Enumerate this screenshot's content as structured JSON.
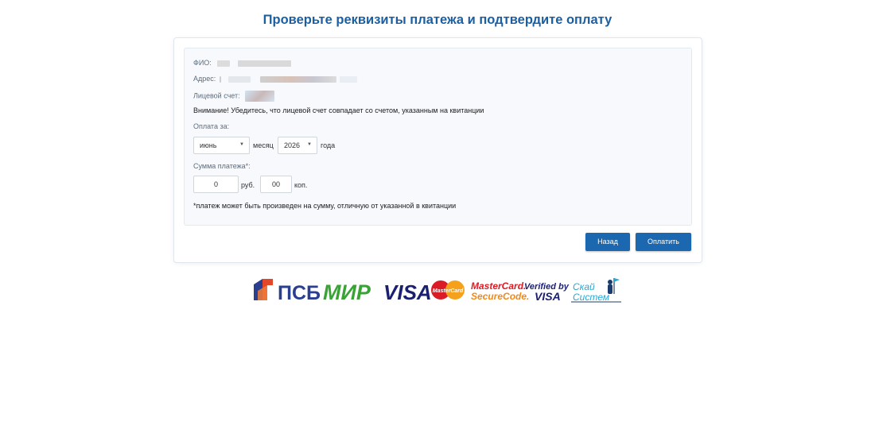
{
  "title": "Проверьте реквизиты платежа и подтвердите оплату",
  "details": {
    "fio_label": "ФИО:",
    "address_label": "Адрес:",
    "account_label": "Лицевой счет:",
    "warning": "Внимание! Убедитесь, что лицевой счет совпадает со счетом, указанным на квитанции"
  },
  "payment_period": {
    "label": "Оплата за:",
    "month_value": "июнь",
    "month_unit": "месяц",
    "year_value": "2026",
    "year_unit": "года"
  },
  "amount": {
    "label": "Сумма платежа*:",
    "rubles_value": "0",
    "rubles_unit": "руб.",
    "kopecks_value": "00",
    "kopecks_unit": "коп.",
    "note": "*платеж может быть произведен на сумму, отличную от указанной в квитанции"
  },
  "buttons": {
    "back": "Назад",
    "pay": "Оплатить"
  },
  "logos": {
    "psb": "ПСБ",
    "mir": "МИР",
    "visa": "VISA",
    "mastercard": "MasterCard",
    "mc_secure_1": "MasterCard.",
    "mc_secure_2": "SecureCode.",
    "vbv_1": "Verified by",
    "vbv_2": "VISA",
    "sky_1": "Скай",
    "sky_2": "Систем"
  },
  "colors": {
    "accent": "#1b68b0",
    "title": "#1b5fa3",
    "mir_green": "#3aa335",
    "visa_blue": "#1a1f71",
    "mc_red": "#d91c25",
    "mc_orange": "#f5a11b"
  }
}
